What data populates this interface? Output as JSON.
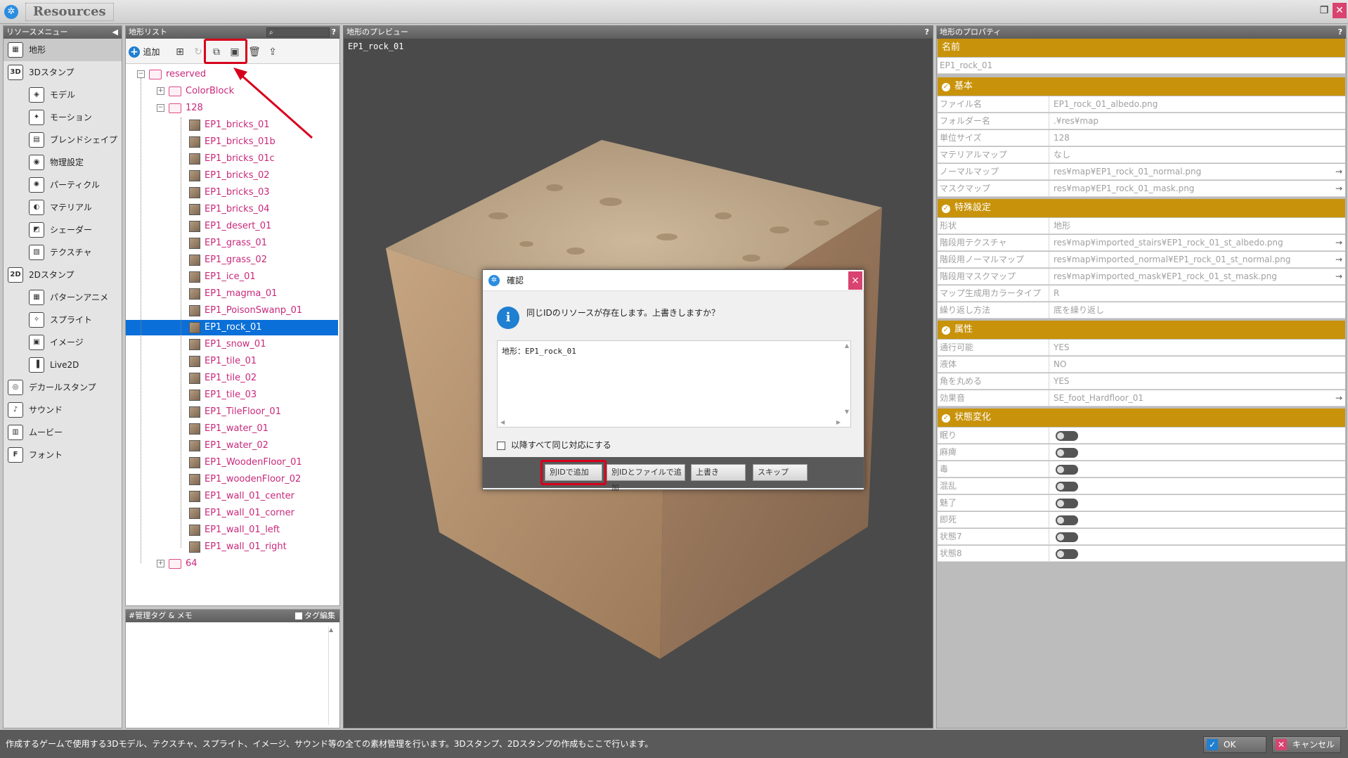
{
  "window": {
    "title": "Resources",
    "restore_icon": "restore-icon",
    "close_icon": "close-icon"
  },
  "left_menu": {
    "header": "リソースメニュー",
    "items": [
      {
        "label": "地形",
        "icon": "terrain-icon",
        "level": 0,
        "selected": true
      },
      {
        "label": "3Dスタンプ",
        "icon": "3d-stamp-icon",
        "level": 0
      },
      {
        "label": "モデル",
        "icon": "model-icon",
        "level": 1
      },
      {
        "label": "モーション",
        "icon": "motion-icon",
        "level": 1
      },
      {
        "label": "ブレンドシェイプ",
        "icon": "blendshape-icon",
        "level": 1
      },
      {
        "label": "物理設定",
        "icon": "physics-icon",
        "level": 1
      },
      {
        "label": "パーティクル",
        "icon": "particle-icon",
        "level": 1
      },
      {
        "label": "マテリアル",
        "icon": "material-icon",
        "level": 1
      },
      {
        "label": "シェーダー",
        "icon": "shader-icon",
        "level": 1
      },
      {
        "label": "テクスチャ",
        "icon": "texture-icon",
        "level": 1
      },
      {
        "label": "2Dスタンプ",
        "icon": "2d-stamp-icon",
        "level": 0
      },
      {
        "label": "パターンアニメ",
        "icon": "pattern-anim-icon",
        "level": 1
      },
      {
        "label": "スプライト",
        "icon": "sprite-icon",
        "level": 1
      },
      {
        "label": "イメージ",
        "icon": "image-icon",
        "level": 1
      },
      {
        "label": "Live2D",
        "icon": "live2d-icon",
        "level": 1
      },
      {
        "label": "デカールスタンプ",
        "icon": "decal-stamp-icon",
        "level": 0
      },
      {
        "label": "サウンド",
        "icon": "sound-icon",
        "level": 0
      },
      {
        "label": "ムービー",
        "icon": "movie-icon",
        "level": 0
      },
      {
        "label": "フォント",
        "icon": "font-icon",
        "level": 0
      }
    ]
  },
  "terrain_list": {
    "header": "地形リスト",
    "help": "?",
    "add_label": "追加",
    "tree": {
      "root": "reserved",
      "colorblock": "ColorBlock",
      "folder_128": "128",
      "items": [
        "EP1_bricks_01",
        "EP1_bricks_01b",
        "EP1_bricks_01c",
        "EP1_bricks_02",
        "EP1_bricks_03",
        "EP1_bricks_04",
        "EP1_desert_01",
        "EP1_grass_01",
        "EP1_grass_02",
        "EP1_ice_01",
        "EP1_magma_01",
        "EP1_PoisonSwanp_01",
        "EP1_rock_01",
        "EP1_snow_01",
        "EP1_tile_01",
        "EP1_tile_02",
        "EP1_tile_03",
        "EP1_TileFloor_01",
        "EP1_water_01",
        "EP1_water_02",
        "EP1_WoodenFloor_01",
        "EP1_woodenFloor_02",
        "EP1_wall_01_center",
        "EP1_wall_01_corner",
        "EP1_wall_01_left",
        "EP1_wall_01_right"
      ],
      "selected": "EP1_rock_01",
      "folder_64": "64"
    }
  },
  "tag_panel": {
    "header": "#管理タグ & メモ",
    "edit_label": "タグ編集"
  },
  "preview": {
    "header": "地形のプレビュー",
    "help": "?",
    "caption": "EP1_rock_01"
  },
  "properties": {
    "header": "地形のプロパティ",
    "help": "?",
    "name_header": "名前",
    "name_value": "EP1_rock_01",
    "sections": {
      "basic": "基本",
      "special": "特殊設定",
      "attribute": "属性",
      "status": "状態変化"
    },
    "basic_rows": [
      {
        "key": "ファイル名",
        "value": "EP1_rock_01_albedo.png",
        "arrow": false
      },
      {
        "key": "フォルダー名",
        "value": ".¥res¥map",
        "arrow": false
      },
      {
        "key": "単位サイズ",
        "value": "128",
        "arrow": false
      },
      {
        "key": "マテリアルマップ",
        "value": "なし",
        "arrow": false
      },
      {
        "key": "ノーマルマップ",
        "value": "res¥map¥EP1_rock_01_normal.png",
        "arrow": true
      },
      {
        "key": "マスクマップ",
        "value": "res¥map¥EP1_rock_01_mask.png",
        "arrow": true
      }
    ],
    "special_rows": [
      {
        "key": "形状",
        "value": "地形",
        "arrow": false
      },
      {
        "key": "階段用テクスチャ",
        "value": "res¥map¥imported_stairs¥EP1_rock_01_st_albedo.png",
        "arrow": true
      },
      {
        "key": "階段用ノーマルマップ",
        "value": "res¥map¥imported_normal¥EP1_rock_01_st_normal.png",
        "arrow": true
      },
      {
        "key": "階段用マスクマップ",
        "value": "res¥map¥imported_mask¥EP1_rock_01_st_mask.png",
        "arrow": true
      },
      {
        "key": "マップ生成用カラータイプ",
        "value": "R",
        "arrow": false
      },
      {
        "key": "繰り返し方法",
        "value": "底を繰り返し",
        "arrow": false
      }
    ],
    "attribute_rows": [
      {
        "key": "通行可能",
        "value": "YES",
        "arrow": false
      },
      {
        "key": "液体",
        "value": "NO",
        "arrow": false
      },
      {
        "key": "角を丸める",
        "value": "YES",
        "arrow": false
      },
      {
        "key": "効果音",
        "value": "SE_foot_Hardfloor_01",
        "arrow": true
      }
    ],
    "status_rows": [
      "眠り",
      "麻痺",
      "毒",
      "混乱",
      "魅了",
      "即死",
      "状態7",
      "状態8"
    ]
  },
  "dialog": {
    "title": "確認",
    "message": "同じIDのリソースが存在します。上書きしますか？",
    "list_text": "地形：EP1_rock_01",
    "checkbox_label": "以降すべて同じ対応にする",
    "buttons": {
      "add_new_id": "別IDで追加",
      "add_new_id_file": "別IDとファイルで追加",
      "overwrite": "上書き",
      "skip": "スキップ"
    }
  },
  "status_bar": {
    "text": "作成するゲームで使用する3Dモデル、テクスチャ、スプライト、イメージ、サウンド等の全ての素材管理を行います。3Dスタンプ、2Dスタンプの作成もここで行います。",
    "ok_label": "OK",
    "cancel_label": "キャンセル"
  },
  "colors": {
    "accent_gold": "#c8930a",
    "selection_blue": "#0a6fd8",
    "tree_text": "#c8287a",
    "annotation_red": "#d6001c"
  }
}
